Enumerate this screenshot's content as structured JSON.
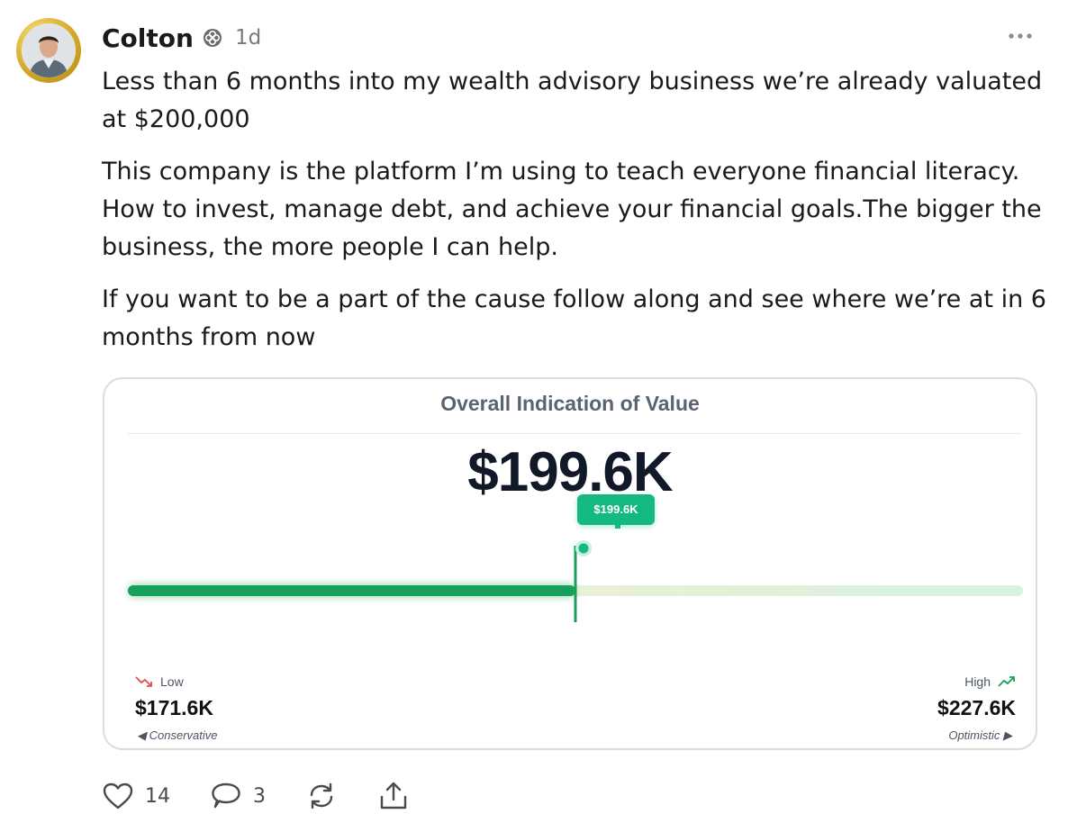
{
  "post": {
    "author": "Colton",
    "timestamp": "1d",
    "paragraphs": [
      "Less than 6 months into my wealth advisory business we’re already valuated at $200,000",
      "This company is the platform I’m using to teach everyone financial literacy. How to invest, manage debt, and achieve your financial goals.The bigger the business, the more people I can help.",
      "If you want to be a part of the cause follow along and see where we’re at in 6 months from now"
    ],
    "icons": {
      "badge": "verified-badge-icon",
      "more": "more-options-icon"
    }
  },
  "valuation_card": {
    "title": "Overall Indication of Value",
    "value_label": "$199.6K",
    "marker_label": "$199.6K",
    "range": {
      "low": {
        "label": "Low",
        "value": "$171.6K",
        "note": "◀ Conservative",
        "amount": 171.6
      },
      "high": {
        "label": "High",
        "value": "$227.6K",
        "note": "Optimistic ▶",
        "amount": 227.6
      },
      "current_amount": 199.6
    },
    "colors": {
      "filled": "#16a05a",
      "marker": "#14b882",
      "low_trend": "#d9534f",
      "high_trend": "#16a05a"
    }
  },
  "actions": {
    "like_count": "14",
    "comment_count": "3",
    "icons": [
      "heart-icon",
      "comment-icon",
      "repost-icon",
      "share-icon"
    ]
  }
}
